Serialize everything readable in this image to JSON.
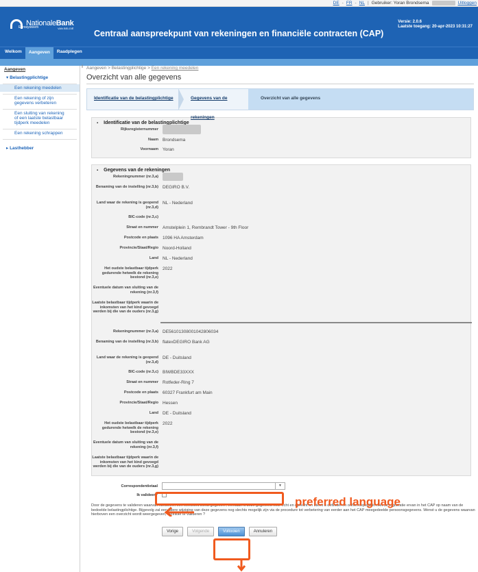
{
  "topbar": {
    "lang_de": "DE",
    "lang_fr": "FR",
    "lang_nl": "NL",
    "user_prefix": "Gebruiker: Yoran Brondsema",
    "logout": "Uitloggen"
  },
  "header": {
    "logo_main": "Nationale",
    "logo_bold": "Bank",
    "logo_sub": "VAN BELGIË",
    "logo_euro": "Eurosysteem",
    "title": "Centraal aanspreekpunt van rekeningen en financiële contracten (CAP)",
    "version": "Versie: 2.0.6",
    "last_access": "Laatste toegang: 20-apr-2023 10:31:27"
  },
  "nav": {
    "items": [
      "Welkom",
      "Aangeven",
      "Raadplegen"
    ]
  },
  "sidebar": {
    "heading": "Aangeven",
    "group1": "Belastingplichtige",
    "items": [
      "Een rekening meedelen",
      "Een rekening of zijn gegevens verbeteren",
      "Een sluiting van rekening of een laatste belastbaar tijdperk meedelen",
      "Een rekening schrappen"
    ],
    "group2": "Lasthebber"
  },
  "breadcrumb": {
    "a": "Aangeven",
    "b": "Belastingplichtige",
    "c": "Een rekening meedelen",
    "sep": ">"
  },
  "page_title": "Overzicht van alle gegevens",
  "steps": [
    "Identificatie van de belastingplichtige",
    "Gegevens van de rekeningen",
    "Overzicht van alle gegevens"
  ],
  "identification": {
    "title": "Identificatie van de belastingplichtige",
    "labels": {
      "rijks": "Rijksregisternummer",
      "naam": "Naam",
      "voornaam": "Voornaam"
    },
    "values": {
      "naam": "Brondsema",
      "voornaam": "Yoran"
    }
  },
  "accounts": {
    "title": "Gegevens van de rekeningen",
    "labels": {
      "nummer": "Rekeningnummer (nr.3,a)",
      "instelling": "Benaming van de instelling (nr.3,b)",
      "land": "Land waar de rekening is geopend (nr.3,d)",
      "bic": "BIC-code (nr.3,c)",
      "straat": "Straat en nummer",
      "postcode": "Postcode en plaats",
      "provincie": "Provincie/Staat/Regio",
      "land2": "Land",
      "oudste": "Het oudste belastbaar tijdperk gedurende hetwelk de rekening bestond (nr.3,e)",
      "sluiting": "Eventuele datum van sluiting van de rekening (nr.3,f)",
      "laatste": "Laatste belastbaar tijdperk waarin de inkomsten van het kind gevoegd werden bij die van de ouders (nr.3,g)"
    },
    "list": [
      {
        "nummer": "",
        "instelling": "DEGIRO B.V.",
        "land": "NL - Nederland",
        "bic": "",
        "straat": "Amstelplein 1, Rembrandt Tower - 9th Floor",
        "postcode": "1096 HA Amsterdam",
        "provincie": "Noord-Holland",
        "land2": "NL - Nederland",
        "oudste": "2022",
        "sluiting": "",
        "laatste": ""
      },
      {
        "nummer": "DE56101308001042806034",
        "instelling": "flatexDEGIRO Bank AG",
        "land": "DE - Duitsland",
        "bic": "BIWBDE33XXX",
        "straat": "Rotfeder-Ring 7",
        "postcode": "60327 Frankfurt am Main",
        "provincie": "Hessen",
        "land2": "DE - Duitsland",
        "oudste": "2022",
        "sluiting": "",
        "laatste": ""
      }
    ]
  },
  "form": {
    "corr_label": "Correspondentietaal",
    "corr_value": "",
    "validate_label": "Ik valideer *",
    "disclaimer": "Door de gegevens te valideren waarvan hierboven een overzicht wordt gegeven , verklaart u deze gegevens voor echt en oprecht en stemt u definitief en onherroepelijk in met de registratie ervan in het CAP op naam van de bedoelde belastingplichtige. Bijgevolg zal een latere wijziging van deze gegevens nog slechts mogelijk zijn via de procedure tot verbetering van eerder aan het CAP meegedeelde persoonsgegevens. Wenst u de gegevens waarvan hierboven een overzicht wordt weergegeven, definitief te valideren ?"
  },
  "buttons": {
    "prev": "Vorige",
    "next": "Volgende",
    "finish": "Voltooien",
    "cancel": "Annuleren"
  },
  "annotation": {
    "text": "preferred language",
    "color": "#f05a1e"
  }
}
